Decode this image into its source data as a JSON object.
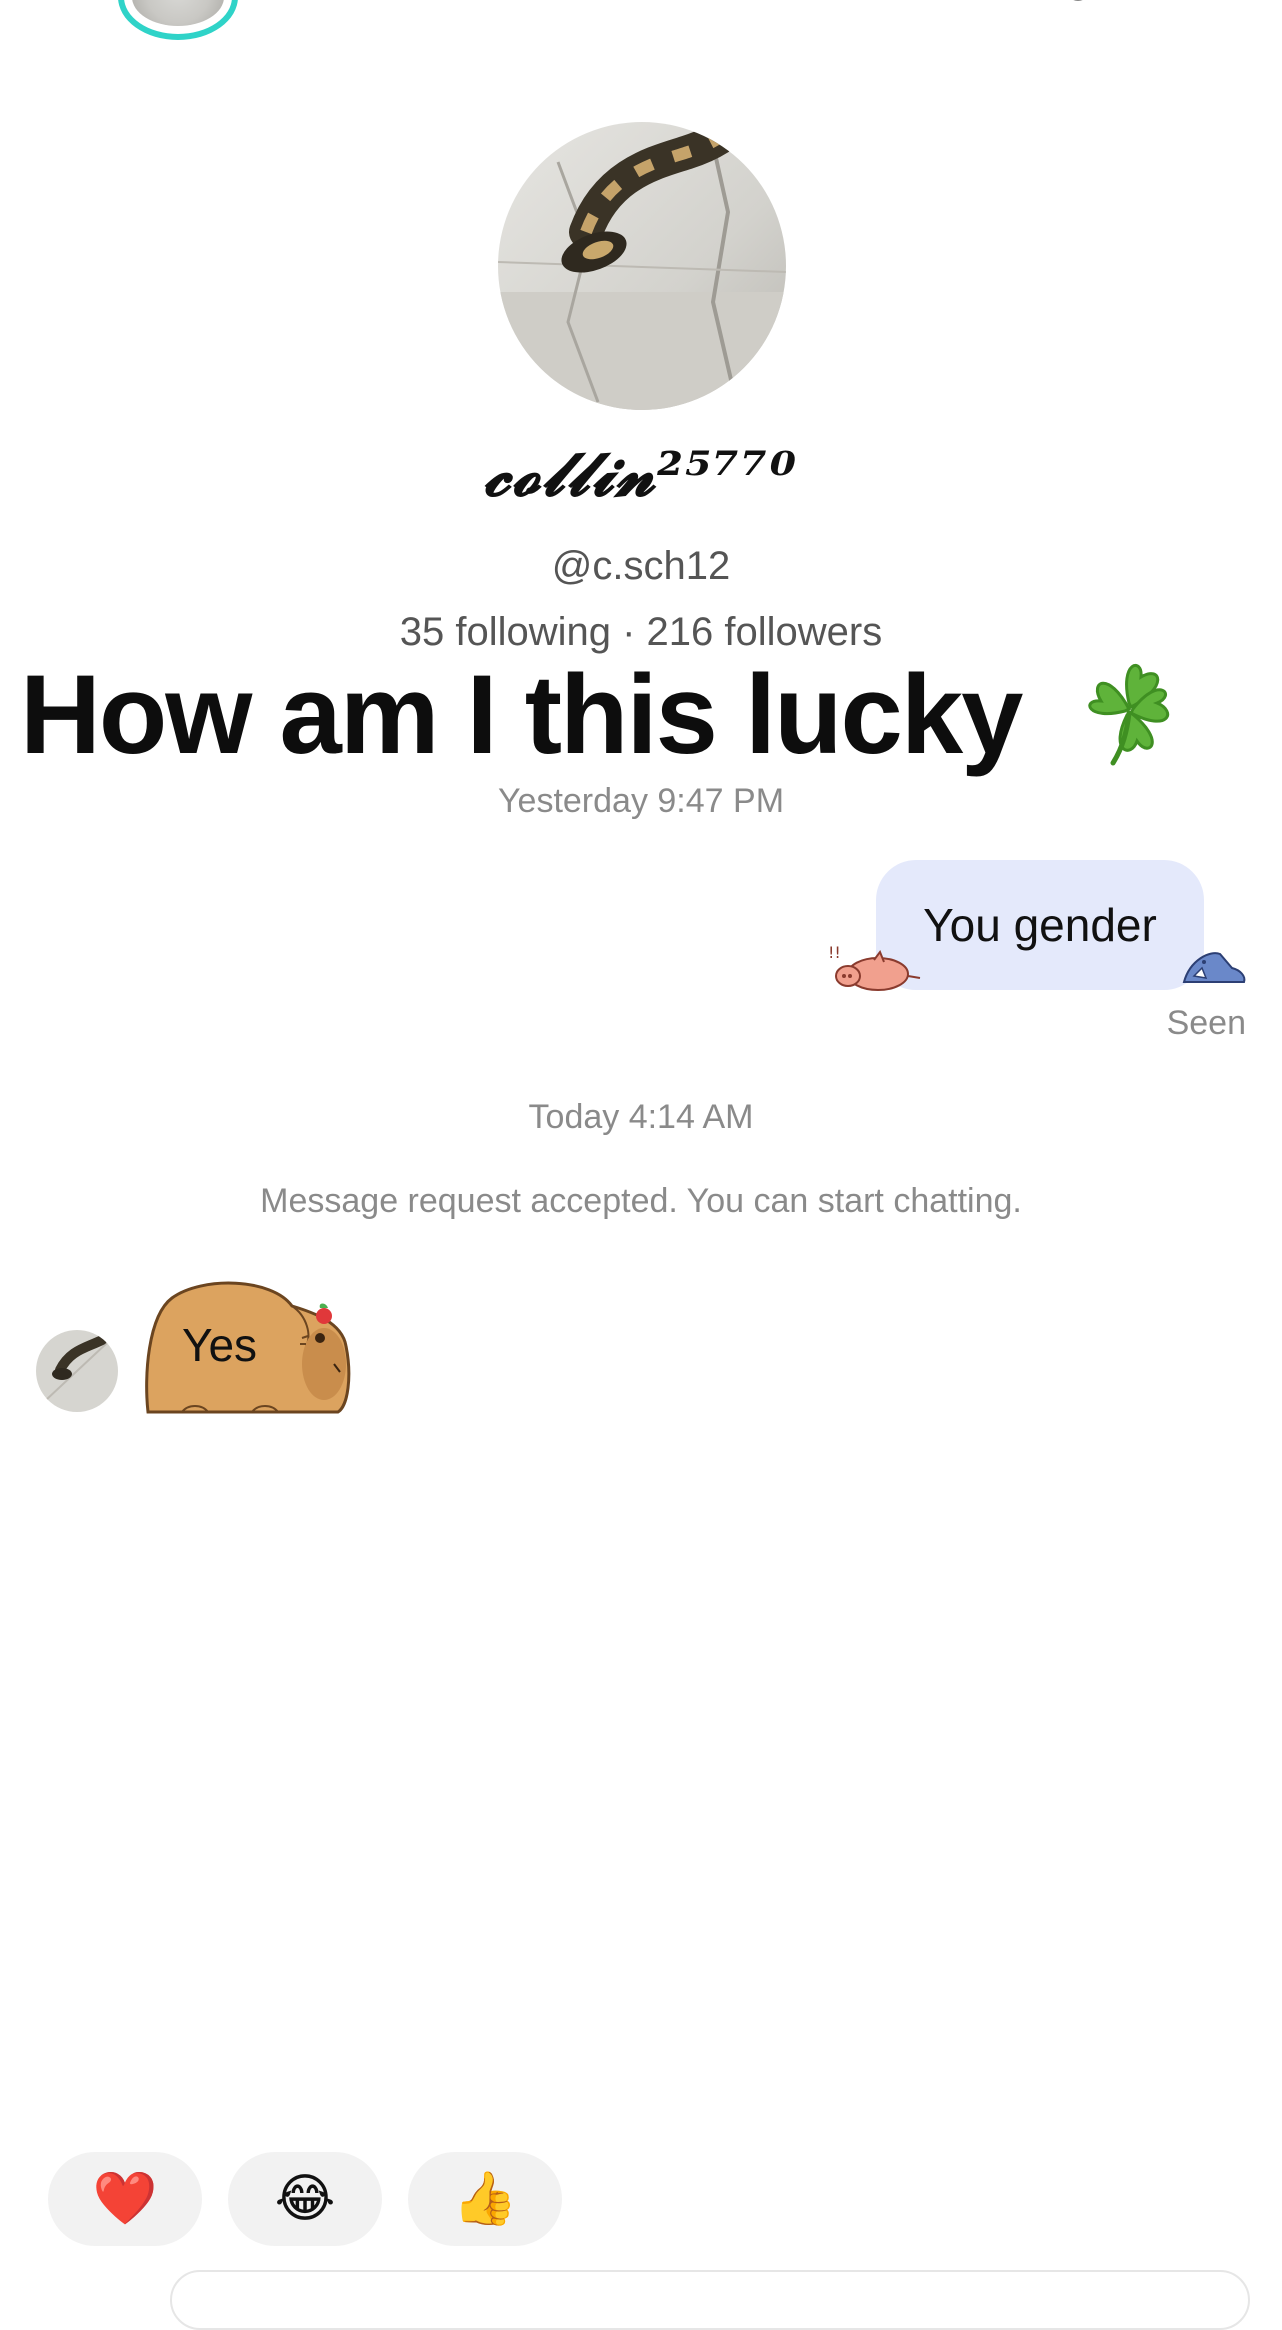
{
  "header": {
    "back_icon": "chevron-left-icon",
    "info_icon": "info-icon",
    "story_ring_color": "#2fd3c8"
  },
  "profile": {
    "name": "𝓬𝓸𝓵𝓵𝓲𝓷²⁵⁷⁷⁰",
    "handle": "@c.sch12",
    "stats": "35 following · 216 followers"
  },
  "overlay_caption": {
    "text": "How am I this lucky",
    "emoji": "🍀"
  },
  "conversation": {
    "timestamp_1": "Yesterday 9:47 PM",
    "outgoing_message": "You gender",
    "outgoing_bubble_color": "#e4e9fb",
    "seen_label": "Seen",
    "timestamp_2": "Today 4:14 AM",
    "system_note": "Message request accepted. You can start chatting.",
    "incoming_message": "Yes"
  },
  "quick_reactions": [
    "❤️",
    "😂",
    "👍"
  ]
}
